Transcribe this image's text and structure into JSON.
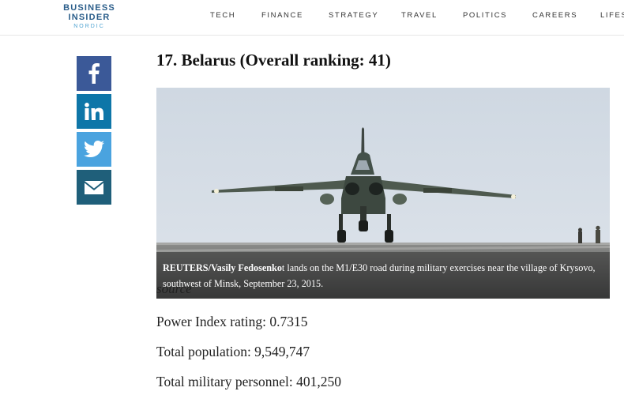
{
  "brand": {
    "line1": "BUSINESS",
    "line2": "INSIDER",
    "line3": "NORDIC"
  },
  "nav": {
    "items": [
      "TECH",
      "FINANCE",
      "STRATEGY",
      "TRAVEL",
      "POLITICS",
      "CAREERS",
      "LIFES"
    ]
  },
  "share": {
    "icons": [
      "facebook-icon",
      "linkedin-icon",
      "twitter-icon",
      "email-icon"
    ],
    "colors": {
      "facebook": "#3b5998",
      "linkedin": "#0e76a8",
      "twitter": "#4aa3df",
      "email": "#1f5f7a"
    }
  },
  "article": {
    "headline": "17. Belarus (Overall ranking: 41)",
    "photo": {
      "credit": "REUTERS/Vasily Fedosenko",
      "caption": "t lands on the M1/E30 road during military exercises near the village of Krysovo, southwest of Minsk, September 23, 2015."
    },
    "source_label": "source",
    "stats": [
      "Power Index rating: 0.7315",
      "Total population: 9,549,747",
      "Total military personnel: 401,250"
    ]
  }
}
